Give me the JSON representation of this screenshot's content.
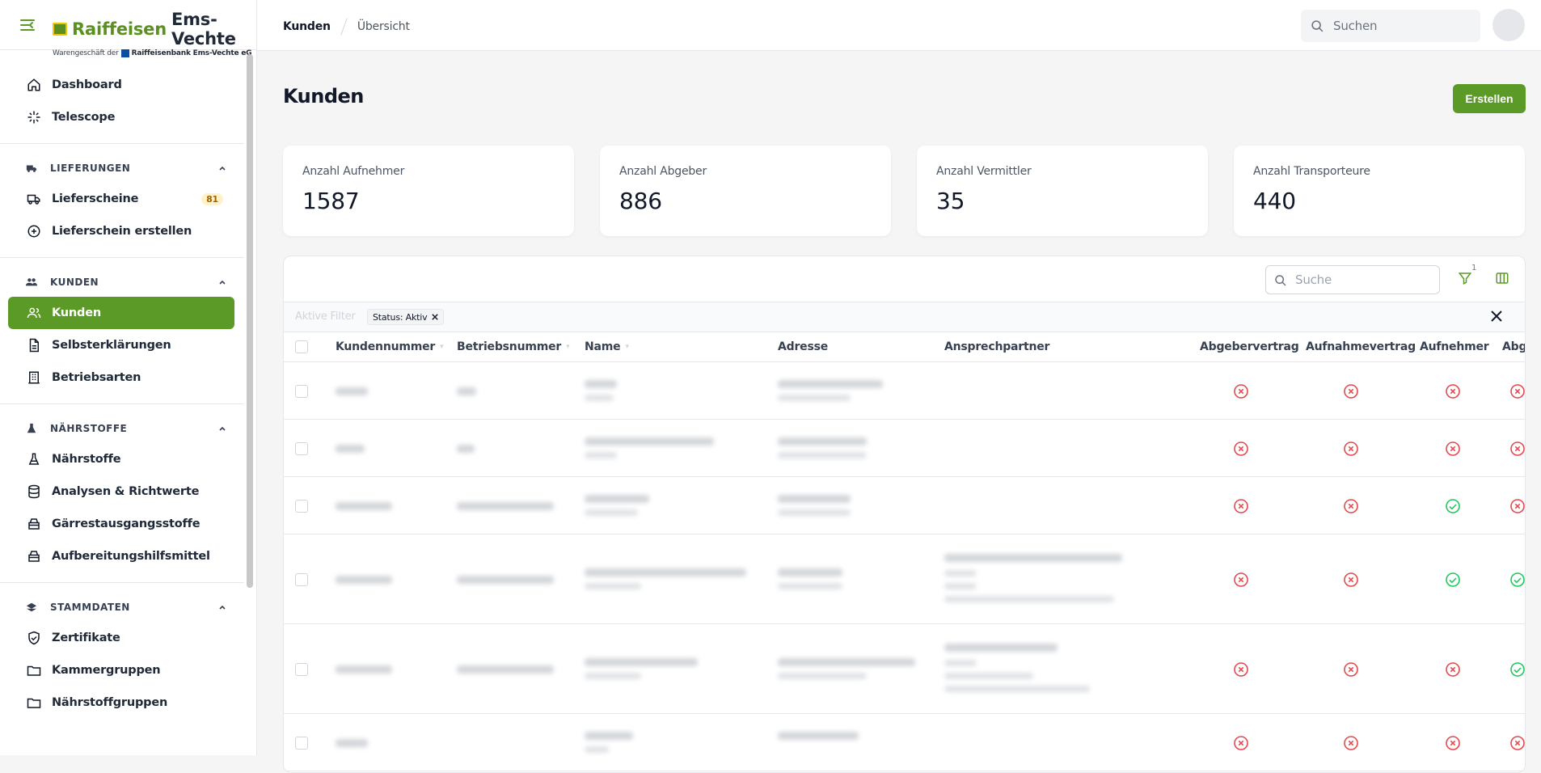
{
  "brand": {
    "name_part1": "Raiffeisen",
    "name_part2": "Ems-Vechte",
    "sub_part1": "Warengeschäft der",
    "sub_part2": "Raiffeisenbank Ems-Vechte eG"
  },
  "sidebar": {
    "top_items": [
      {
        "label": "Dashboard",
        "icon": "home-icon"
      },
      {
        "label": "Telescope",
        "icon": "sparkle-icon"
      }
    ],
    "sections": [
      {
        "title": "LIEFERUNGEN",
        "icon": "truck-icon",
        "items": [
          {
            "label": "Lieferscheine",
            "badge": "81",
            "icon": "truck-icon"
          },
          {
            "label": "Lieferschein erstellen",
            "icon": "plus-circle-icon"
          }
        ]
      },
      {
        "title": "KUNDEN",
        "icon": "users-icon",
        "items": [
          {
            "label": "Kunden",
            "active": true,
            "icon": "users-icon"
          },
          {
            "label": "Selbsterklärungen",
            "icon": "document-icon"
          },
          {
            "label": "Betriebsarten",
            "icon": "building-icon"
          }
        ]
      },
      {
        "title": "NÄHRSTOFFE",
        "icon": "flask-icon",
        "items": [
          {
            "label": "Nährstoffe",
            "icon": "flask-icon"
          },
          {
            "label": "Analysen & Richtwerte",
            "icon": "database-icon"
          },
          {
            "label": "Gärrestausgangsstoffe",
            "icon": "archive-icon"
          },
          {
            "label": "Aufbereitungshilfsmittel",
            "icon": "archive-icon"
          }
        ]
      },
      {
        "title": "STAMMDATEN",
        "icon": "stack-icon",
        "items": [
          {
            "label": "Zertifikate",
            "icon": "shield-icon"
          },
          {
            "label": "Kammergruppen",
            "icon": "folder-icon"
          },
          {
            "label": "Nährstoffgruppen",
            "icon": "folder-icon"
          }
        ]
      }
    ]
  },
  "header": {
    "breadcrumb": [
      "Kunden",
      "Übersicht"
    ],
    "search_placeholder": "Suchen"
  },
  "page": {
    "title": "Kunden",
    "create_label": "Erstellen"
  },
  "stats": [
    {
      "label": "Anzahl Aufnehmer",
      "value": "1587"
    },
    {
      "label": "Anzahl Abgeber",
      "value": "886"
    },
    {
      "label": "Anzahl Vermittler",
      "value": "35"
    },
    {
      "label": "Anzahl Transporteure",
      "value": "440"
    }
  ],
  "table": {
    "search_placeholder": "Suche",
    "filter_count": "1",
    "active_filter_label": "Aktive Filter",
    "filter_chip": "Status: Aktiv",
    "columns": [
      "Kundennummer",
      "Betriebsnummer",
      "Name",
      "Adresse",
      "Ansprechpartner",
      "Abgebervertrag",
      "Aufnahmevertrag",
      "Aufnehmer",
      "Abgeber"
    ],
    "rows": [
      {
        "status": [
          "no",
          "no",
          "no",
          "no"
        ]
      },
      {
        "status": [
          "no",
          "no",
          "no",
          "no"
        ]
      },
      {
        "status": [
          "no",
          "no",
          "yes",
          "no"
        ]
      },
      {
        "status": [
          "no",
          "no",
          "yes",
          "yes"
        ]
      },
      {
        "status": [
          "no",
          "no",
          "no",
          "yes"
        ]
      },
      {
        "status": [
          "no",
          "no",
          "no",
          "no"
        ]
      }
    ]
  },
  "colors": {
    "accent": "#5b9a26",
    "negative": "#e5484d",
    "positive": "#22c55e"
  }
}
